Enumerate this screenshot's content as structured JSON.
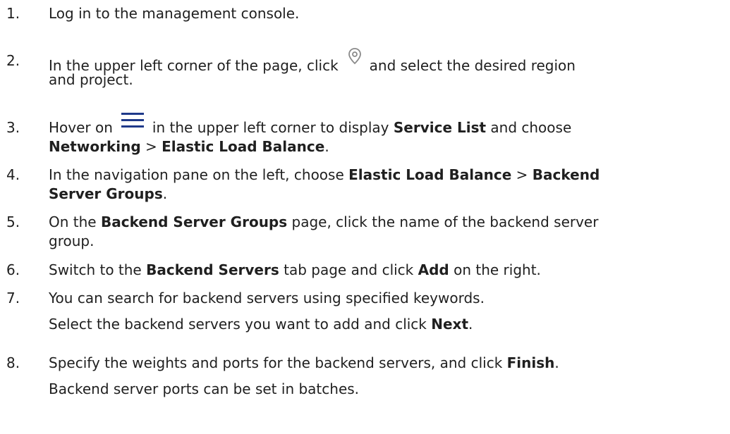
{
  "steps": [
    {
      "number": "1.",
      "lines": [
        {
          "text": "Log in to the management console."
        }
      ]
    },
    {
      "number": "2.",
      "lines": [
        {
          "before_icon": "In the upper left corner of the page, click",
          "icon": "location-pin-icon",
          "after_icon": "and select the desired region"
        },
        {
          "text": "and project."
        }
      ]
    },
    {
      "number": "3.",
      "lines": [
        {
          "before_icon": "Hover on",
          "icon": "hamburger-menu-icon",
          "after_icon_a": "in the upper left corner to display ",
          "bold_1": "Service List",
          "after_bold_1": " and choose"
        },
        {
          "bold_a": "Networking",
          "mid": " > ",
          "bold_b": "Elastic Load Balance",
          "end": "."
        }
      ]
    },
    {
      "number": "4.",
      "lines": [
        {
          "a": "In the navigation pane on the left, choose ",
          "bold_a": "Elastic Load Balance",
          "mid": " > ",
          "bold_b": "Backend"
        },
        {
          "bold_a": "Server Groups",
          "end": "."
        }
      ]
    },
    {
      "number": "5.",
      "lines": [
        {
          "a": "On the ",
          "bold_a": "Backend Server Groups",
          "b": " page, click the name of the backend server"
        },
        {
          "text": "group."
        }
      ]
    },
    {
      "number": "6.",
      "lines": [
        {
          "a": "Switch to the ",
          "bold_a": "Backend Servers",
          "b": " tab page and click ",
          "bold_b": "Add",
          "c": " on the right."
        }
      ]
    },
    {
      "number": "7.",
      "lines": [
        {
          "text": "You can search for backend servers using specified keywords."
        },
        {
          "a": "Select the backend servers you want to add and click ",
          "bold_a": "Next",
          "end": "."
        }
      ]
    },
    {
      "number": "8.",
      "lines": [
        {
          "a": "Specify the weights and ports for the backend servers, and click ",
          "bold_a": "Finish",
          "end": "."
        },
        {
          "text": "Backend server ports can be set in batches."
        }
      ]
    }
  ],
  "icons": {
    "pin_color": "#8a8a8a",
    "menu_color": "#1f3a8a"
  }
}
